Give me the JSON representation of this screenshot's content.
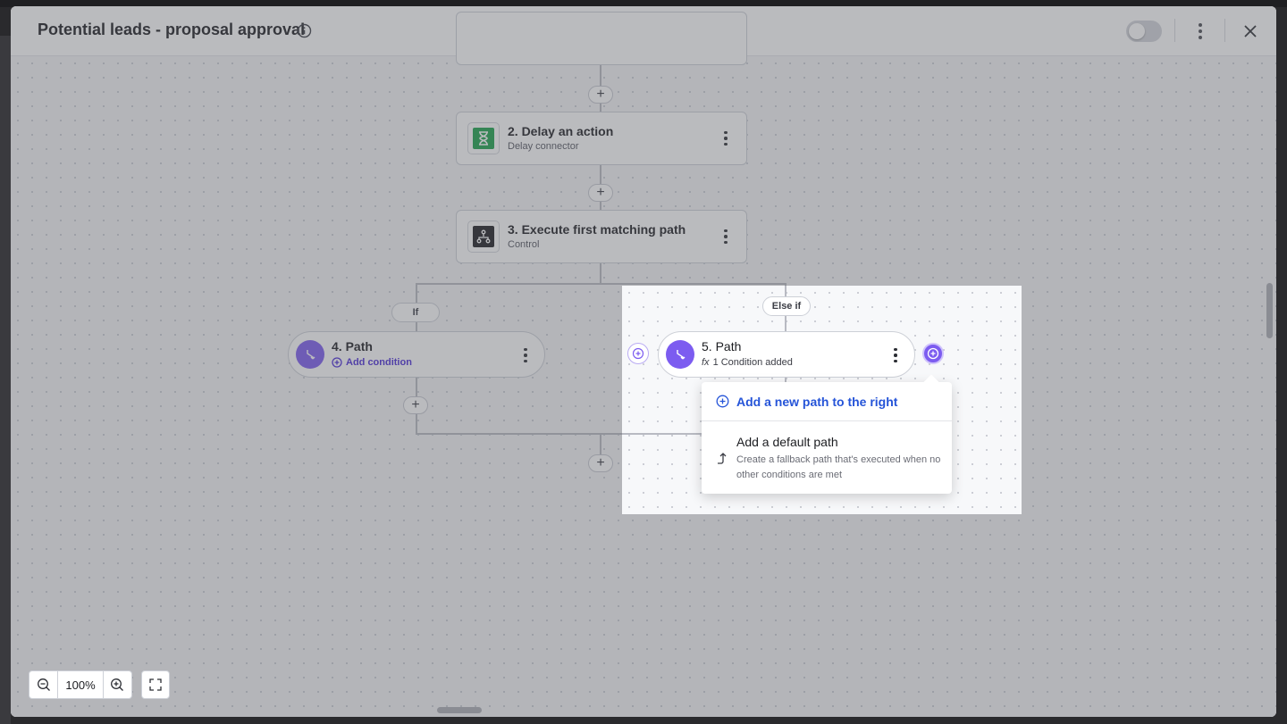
{
  "header": {
    "title": "Potential leads - proposal approval",
    "info_icon": "info-circle-icon",
    "toggle_state": "off",
    "more_icon": "vertical-ellipsis-icon",
    "close_icon": "close-icon"
  },
  "flow": {
    "add_symbol": "+",
    "nodes": [
      {
        "title": "2. Delay an action",
        "subtitle": "Delay connector",
        "icon": "hourglass-icon",
        "icon_color": "#1aa34a"
      },
      {
        "title": "3. Execute first matching path",
        "subtitle": "Control",
        "icon": "branch-control-icon",
        "icon_color": "#1c1d21"
      }
    ],
    "branches": [
      {
        "label": "If",
        "title": "4. Path",
        "subtitle": "Add condition",
        "subtitle_icon": "add-circle-icon"
      },
      {
        "label": "Else if",
        "title": "5. Path",
        "subtitle": "1 Condition added",
        "subtitle_icon": "fx-icon"
      }
    ]
  },
  "menu": {
    "item_add_right": {
      "label": "Add a new path to the right",
      "icon": "add-circle-icon"
    },
    "item_default": {
      "label": "Add a default path",
      "description": "Create a fallback path that's executed when no other conditions are met",
      "icon": "arrow-turn-up-icon"
    }
  },
  "zoom": {
    "value": "100%",
    "zoom_out_icon": "zoom-out-icon",
    "zoom_in_icon": "zoom-in-icon",
    "fit_icon": "fit-screen-icon"
  },
  "colors": {
    "accent_purple": "#7c5cf0",
    "link_blue": "#2554d8",
    "delay_green": "#1aa34a"
  }
}
